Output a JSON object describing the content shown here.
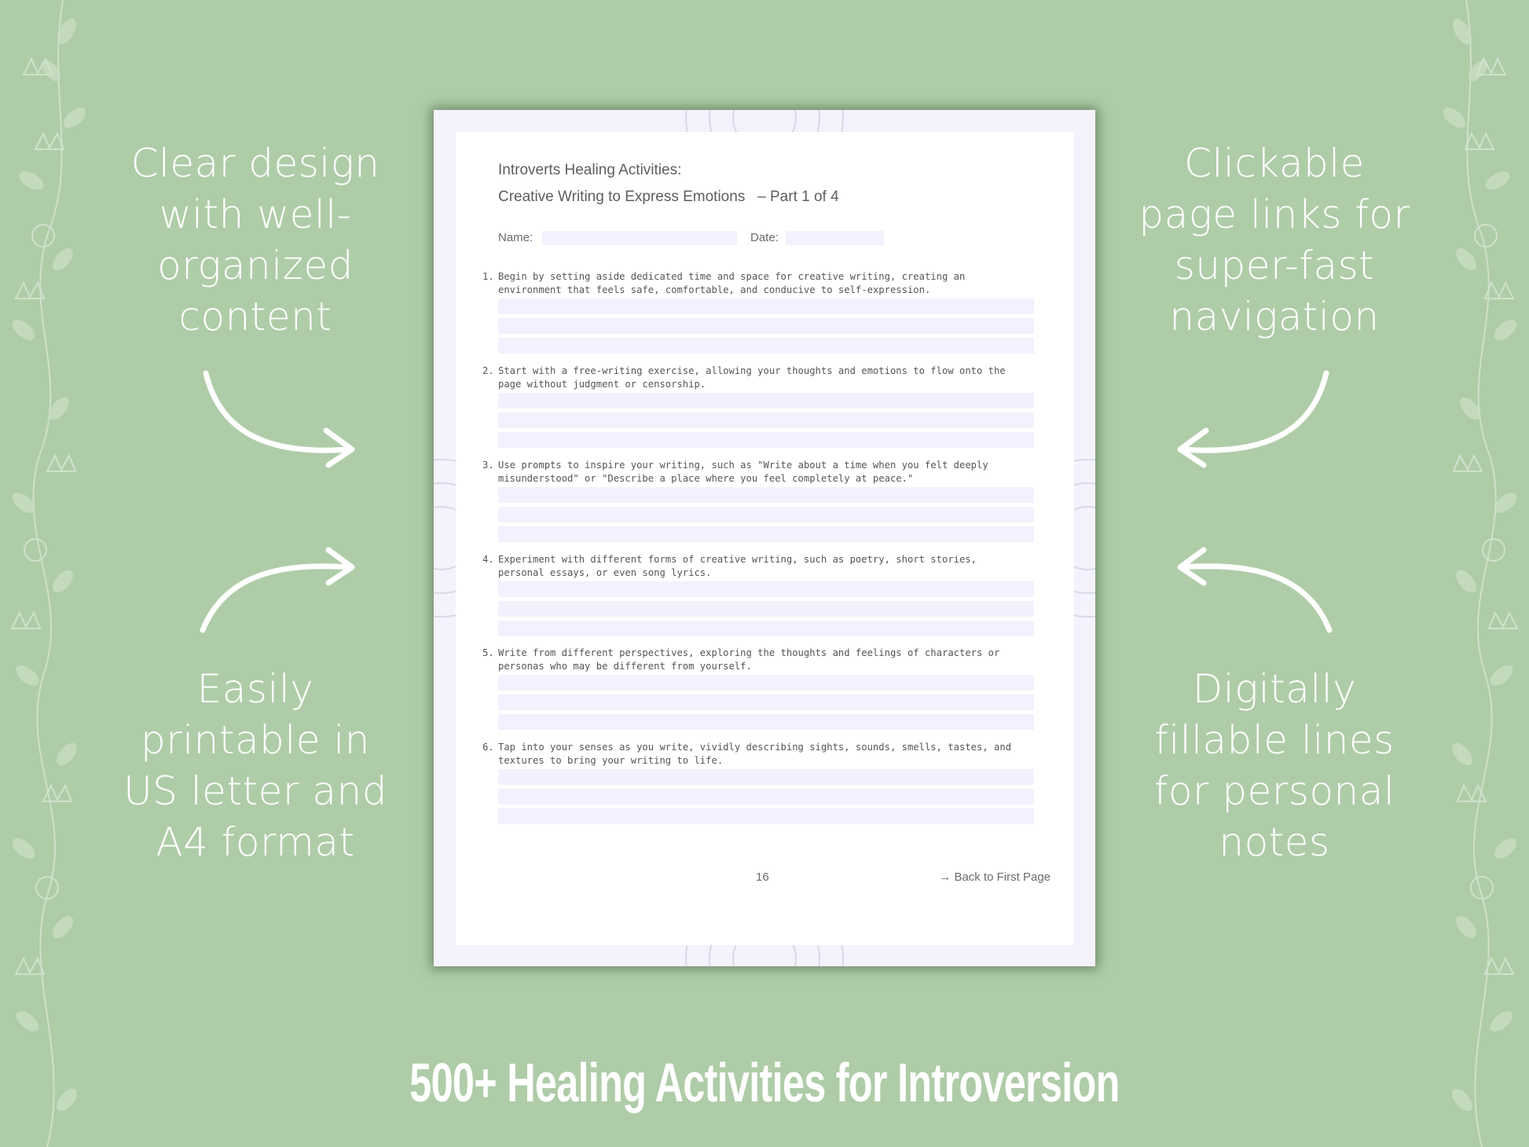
{
  "background_color": "#afcca8",
  "callouts": {
    "top_left": {
      "lines": [
        "Clear design",
        "with well-",
        "organized",
        "content"
      ]
    },
    "bottom_left": {
      "lines": [
        "Easily",
        "printable in",
        "US letter and",
        "A4 format"
      ]
    },
    "top_right": {
      "lines": [
        "Clickable",
        "page links for",
        "super-fast",
        "navigation"
      ]
    },
    "bottom_right": {
      "lines": [
        "Digitally",
        "fillable lines",
        "for personal",
        "notes"
      ]
    }
  },
  "worksheet": {
    "title_line1": "Introverts Healing Activities:",
    "title_line2": "Creative Writing to Express Emotions   – Part 1 of 4",
    "name_label": "Name:",
    "date_label": "Date:",
    "name_value": "",
    "date_value": "",
    "items": [
      {
        "num": "1.",
        "line1": "Begin by setting aside dedicated time and space for creative writing, creating an",
        "line2": "environment that feels safe, comfortable, and conducive to self-expression."
      },
      {
        "num": "2.",
        "line1": "Start with a free-writing exercise, allowing your thoughts and emotions to flow onto the",
        "line2": "page without judgment or censorship."
      },
      {
        "num": "3.",
        "line1": "Use prompts to inspire your writing, such as \"Write about a time when you felt deeply",
        "line2": "misunderstood\" or \"Describe a place where you feel completely at peace.\""
      },
      {
        "num": "4.",
        "line1": "Experiment with different forms of creative writing, such as poetry, short stories,",
        "line2": "personal essays, or even song lyrics."
      },
      {
        "num": "5.",
        "line1": "Write from different perspectives, exploring the thoughts and feelings of characters or",
        "line2": "personas who may be different from yourself."
      },
      {
        "num": "6.",
        "line1": "Tap into your senses as you write, vividly describing sights, sounds, smells, tastes, and",
        "line2": "textures to bring your writing to life."
      }
    ],
    "page_number": "16",
    "back_link": "→ Back to First Page",
    "accent_fill_color": "#f3f1fd"
  },
  "headline": "500+ Healing Activities for Introversion"
}
